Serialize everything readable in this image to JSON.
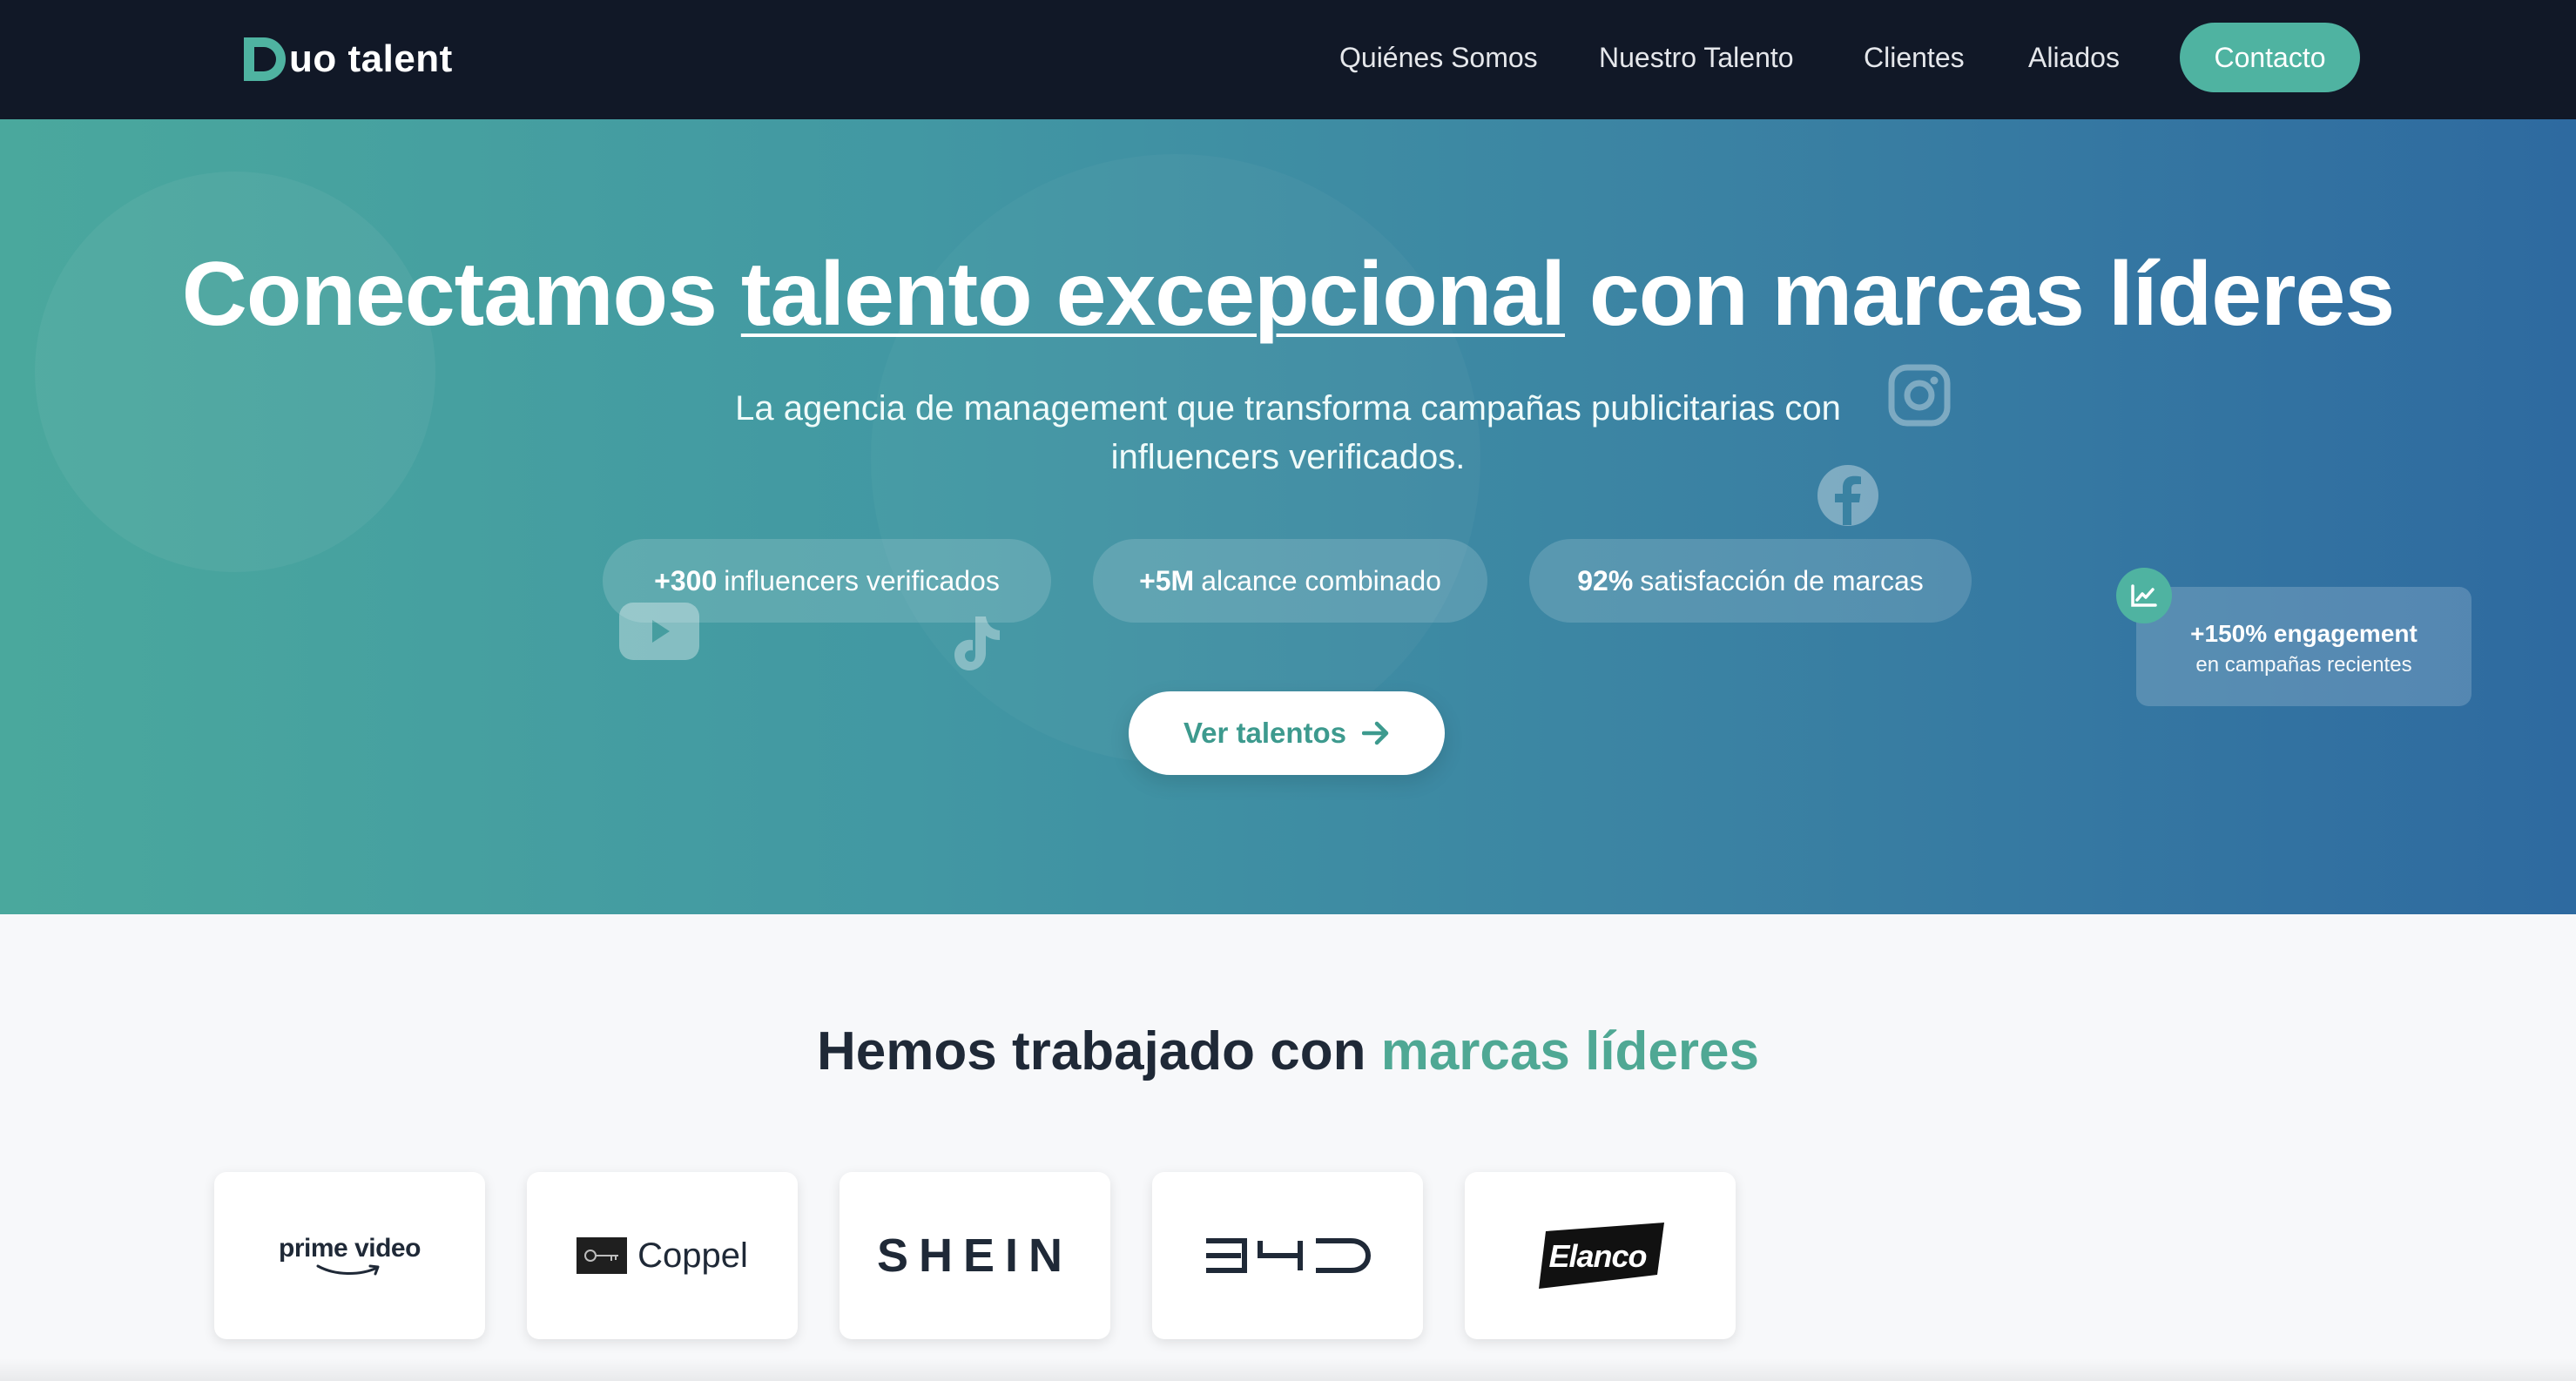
{
  "nav": {
    "logo_text": "uo talent",
    "links": [
      "Quiénes Somos",
      "Nuestro Talento",
      "Clientes",
      "Aliados"
    ],
    "cta": "Contacto"
  },
  "hero": {
    "title_before": "Conectamos ",
    "title_highlight": "talento excepcional",
    "title_after": " con marcas líderes",
    "subtitle_line1": "La agencia de management que transforma campañas publicitarias con",
    "subtitle_line2": "influencers verificados.",
    "stats": [
      {
        "value": "+300",
        "label": "influencers verificados"
      },
      {
        "value": "+5M",
        "label": "alcance combinado"
      },
      {
        "value": "92%",
        "label": "satisfacción de marcas"
      }
    ],
    "cta": "Ver talentos",
    "engagement": {
      "title": "+150% engagement",
      "subtitle": "en campañas recientes"
    }
  },
  "brands": {
    "title_before": "Hemos trabajado con ",
    "title_accent": "marcas líderes",
    "logos": [
      "prime video",
      "Coppel",
      "SHEIN",
      "BYD",
      "Elanco"
    ]
  },
  "colors": {
    "nav_bg": "#111827",
    "accent": "#4fb3a1",
    "hero_gradient_start": "#4aa89d",
    "hero_gradient_end": "#2e6aa0",
    "brands_accent": "#4fa894"
  }
}
